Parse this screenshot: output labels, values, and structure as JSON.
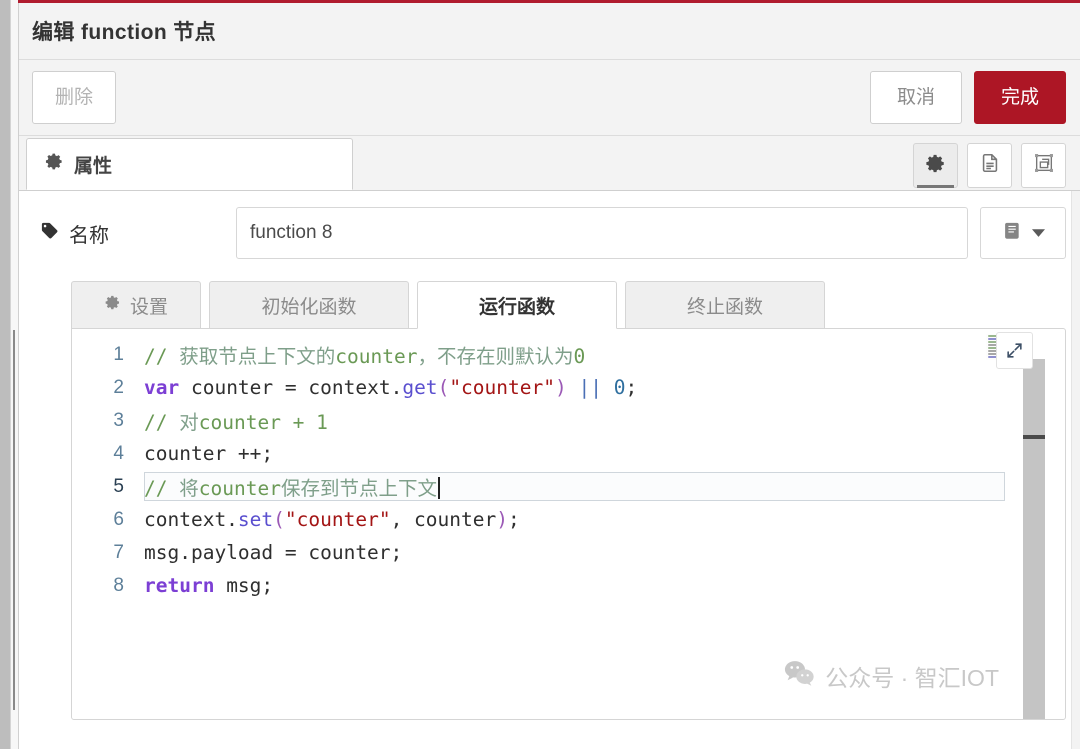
{
  "window": {
    "title": "编辑 function 节点"
  },
  "toolbar": {
    "delete_label": "删除",
    "cancel_label": "取消",
    "done_label": "完成",
    "done_color": "#AD1625"
  },
  "tabs": {
    "properties_label": "属性",
    "properties_icon": "gear-icon",
    "icon_buttons": [
      {
        "name": "settings-icon",
        "active": true
      },
      {
        "name": "description-icon",
        "active": false
      },
      {
        "name": "appearance-icon",
        "active": false
      }
    ]
  },
  "name_field": {
    "label": "名称",
    "icon": "tag-icon",
    "value": "function 8",
    "placeholder": "名称",
    "library_button_icon": "book-icon",
    "library_button_caret": "chevron-down-icon"
  },
  "sub_tabs": [
    {
      "id": "setup",
      "label": "设置",
      "icon": "gear-icon",
      "active": false
    },
    {
      "id": "on-start",
      "label": "初始化函数",
      "icon": "",
      "active": false
    },
    {
      "id": "on-message",
      "label": "运行函数",
      "icon": "",
      "active": true
    },
    {
      "id": "on-stop",
      "label": "终止函数",
      "icon": "",
      "active": false
    }
  ],
  "editor": {
    "active_line": 5,
    "cursor_line": 5,
    "lines": [
      {
        "number": "1",
        "tokens": [
          {
            "t": "// ",
            "c": "t-comment"
          },
          {
            "t": "获取节点上下文的",
            "c": "t-comment-cn"
          },
          {
            "t": "counter",
            "c": "t-comment"
          },
          {
            "t": "，",
            "c": "t-comment-cn"
          },
          {
            "t": "不存在则默认为",
            "c": "t-comment-cn"
          },
          {
            "t": "0",
            "c": "t-comment"
          }
        ],
        "plain": "// 获取节点上下文的counter，不存在则默认为0"
      },
      {
        "number": "2",
        "tokens": [
          {
            "t": "var",
            "c": "t-keyword"
          },
          {
            "t": " counter ",
            "c": "t-plain"
          },
          {
            "t": "=",
            "c": "t-plain"
          },
          {
            "t": " context.",
            "c": "t-plain"
          },
          {
            "t": "get",
            "c": "t-fn"
          },
          {
            "t": "(",
            "c": "t-paren"
          },
          {
            "t": "\"counter\"",
            "c": "t-string"
          },
          {
            "t": ")",
            "c": "t-paren"
          },
          {
            "t": " ",
            "c": "t-plain"
          },
          {
            "t": "||",
            "c": "t-op"
          },
          {
            "t": " ",
            "c": "t-plain"
          },
          {
            "t": "0",
            "c": "t-num"
          },
          {
            "t": ";",
            "c": "t-plain"
          }
        ],
        "plain": "var counter = context.get(\"counter\") || 0;"
      },
      {
        "number": "3",
        "tokens": [
          {
            "t": "// ",
            "c": "t-comment"
          },
          {
            "t": "对",
            "c": "t-comment-cn"
          },
          {
            "t": "counter + 1",
            "c": "t-comment"
          }
        ],
        "plain": "// 对counter + 1"
      },
      {
        "number": "4",
        "tokens": [
          {
            "t": "counter ++;",
            "c": "t-plain"
          }
        ],
        "plain": "counter ++;"
      },
      {
        "number": "5",
        "tokens": [
          {
            "t": "// ",
            "c": "t-comment"
          },
          {
            "t": "将",
            "c": "t-comment-cn"
          },
          {
            "t": "counter",
            "c": "t-comment"
          },
          {
            "t": "保存到节点上下文",
            "c": "t-comment-cn"
          }
        ],
        "plain": "// 将counter保存到节点上下文"
      },
      {
        "number": "6",
        "tokens": [
          {
            "t": "context.",
            "c": "t-plain"
          },
          {
            "t": "set",
            "c": "t-fn"
          },
          {
            "t": "(",
            "c": "t-paren"
          },
          {
            "t": "\"counter\"",
            "c": "t-string"
          },
          {
            "t": ", counter",
            "c": "t-plain"
          },
          {
            "t": ")",
            "c": "t-paren"
          },
          {
            "t": ";",
            "c": "t-plain"
          }
        ],
        "plain": "context.set(\"counter\", counter);"
      },
      {
        "number": "7",
        "tokens": [
          {
            "t": "msg.payload = counter;",
            "c": "t-plain"
          }
        ],
        "plain": "msg.payload = counter;"
      },
      {
        "number": "8",
        "tokens": [
          {
            "t": "return",
            "c": "t-keyword"
          },
          {
            "t": " msg;",
            "c": "t-plain"
          }
        ],
        "plain": "return msg;"
      }
    ],
    "expand_button_icon": "expand-arrows-icon",
    "minimap": "code-minimap"
  },
  "watermark": {
    "icon": "wechat-icon",
    "text": "公众号 · 智汇IOT"
  }
}
